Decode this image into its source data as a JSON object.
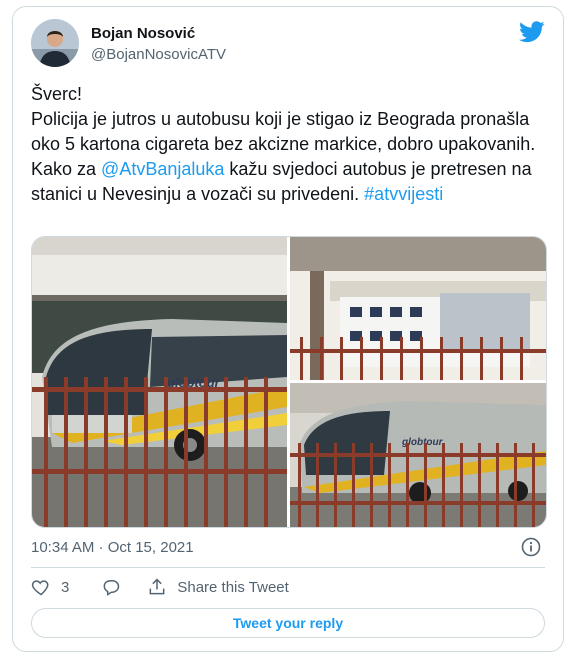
{
  "author": {
    "name": "Bojan Nosović",
    "handle": "@BojanNosovicATV"
  },
  "tweet": {
    "line1": "Šverc!",
    "body": "Policija je jutros u autobusu koji je stigao iz Beograda pronašla oko 5 kartona cigareta bez akcizne markice, dobro upakovanih. Kako za ",
    "mention": "@AtvBanjaluka",
    "body2": " kažu svjedoci autobus je pretresen na stanici u Nevesinju a vozači su privedeni. ",
    "hashtag": "#atvvijesti"
  },
  "timestamp": "10:34 AM · Oct 15, 2021",
  "actions": {
    "like_count": "3",
    "share_label": "Share this Tweet"
  },
  "reply_button": "Tweet your reply",
  "bus_brand": "globtour",
  "colors": {
    "accent": "#1d9bf0",
    "muted": "#536471",
    "border": "#cfd9de"
  }
}
